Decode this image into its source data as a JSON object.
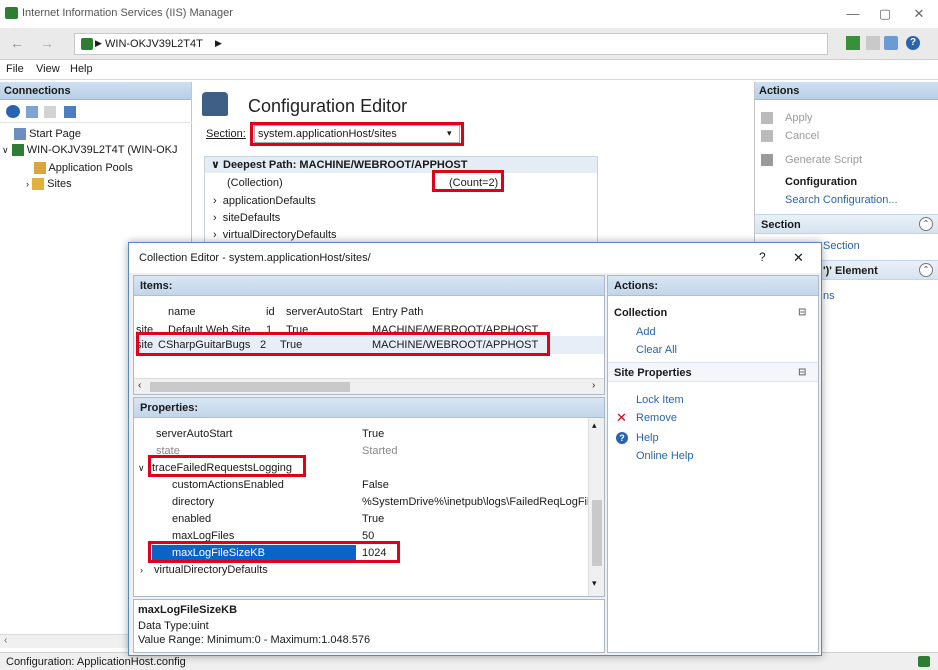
{
  "window": {
    "title": "Internet Information Services (IIS) Manager",
    "address": "WIN-OKJV39L2T4T"
  },
  "menu": [
    "File",
    "View",
    "Help"
  ],
  "connections": {
    "header": "Connections",
    "tree": [
      "Start Page",
      "WIN-OKJV39L2T4T (WIN-OKJ",
      "Application Pools",
      "Sites"
    ]
  },
  "editor": {
    "title": "Configuration Editor",
    "section_label": "Section:",
    "section_value": "system.applicationHost/sites",
    "deepest_path": "Deepest Path: MACHINE/WEBROOT/APPHOST",
    "rows": [
      "(Collection)",
      "applicationDefaults",
      "siteDefaults",
      "virtualDirectoryDefaults"
    ],
    "count": "(Count=2)"
  },
  "actions": {
    "header": "Actions",
    "apply": "Apply",
    "cancel": "Cancel",
    "generate_script": "Generate Script",
    "configuration_header": "Configuration",
    "search_configuration": "Search Configuration...",
    "section_header": "Section",
    "section_partial": "Section",
    "element_partial": "')' Element",
    "ns_partial": "ns"
  },
  "status": "Configuration: ApplicationHost.config",
  "dialog": {
    "title": "Collection Editor - system.applicationHost/sites/",
    "help_btn": "?",
    "close_btn": "✕",
    "items_header": "Items:",
    "columns": [
      "name",
      "id",
      "serverAutoStart",
      "Entry Path"
    ],
    "rows": [
      {
        "type": "site",
        "name": "Default Web Site",
        "id": "1",
        "autostart": "True",
        "path": "MACHINE/WEBROOT/APPHOST"
      },
      {
        "type": "site",
        "name": "CSharpGuitarBugs",
        "id": "2",
        "autostart": "True",
        "path": "MACHINE/WEBROOT/APPHOST"
      }
    ],
    "properties_header": "Properties:",
    "props": [
      {
        "name": "serverAutoStart",
        "value": "True"
      },
      {
        "name": "state",
        "value": "Started"
      },
      {
        "name": "traceFailedRequestsLogging",
        "value": ""
      },
      {
        "name": "customActionsEnabled",
        "value": "False"
      },
      {
        "name": "directory",
        "value": "%SystemDrive%\\inetpub\\logs\\FailedReqLogFil"
      },
      {
        "name": "enabled",
        "value": "True"
      },
      {
        "name": "maxLogFiles",
        "value": "50"
      },
      {
        "name": "maxLogFileSizeKB",
        "value": "1024"
      },
      {
        "name": "virtualDirectoryDefaults",
        "value": ""
      }
    ],
    "desc_title": "maxLogFileSizeKB",
    "desc_type": "Data Type:uint",
    "desc_range": "Value Range: Minimum:0 - Maximum:1.048.576",
    "actions_header": "Actions:",
    "collection_header": "Collection",
    "add": "Add",
    "clear_all": "Clear All",
    "site_props_header": "Site Properties",
    "lock_item": "Lock Item",
    "remove": "Remove",
    "help": "Help",
    "online_help": "Online Help"
  }
}
